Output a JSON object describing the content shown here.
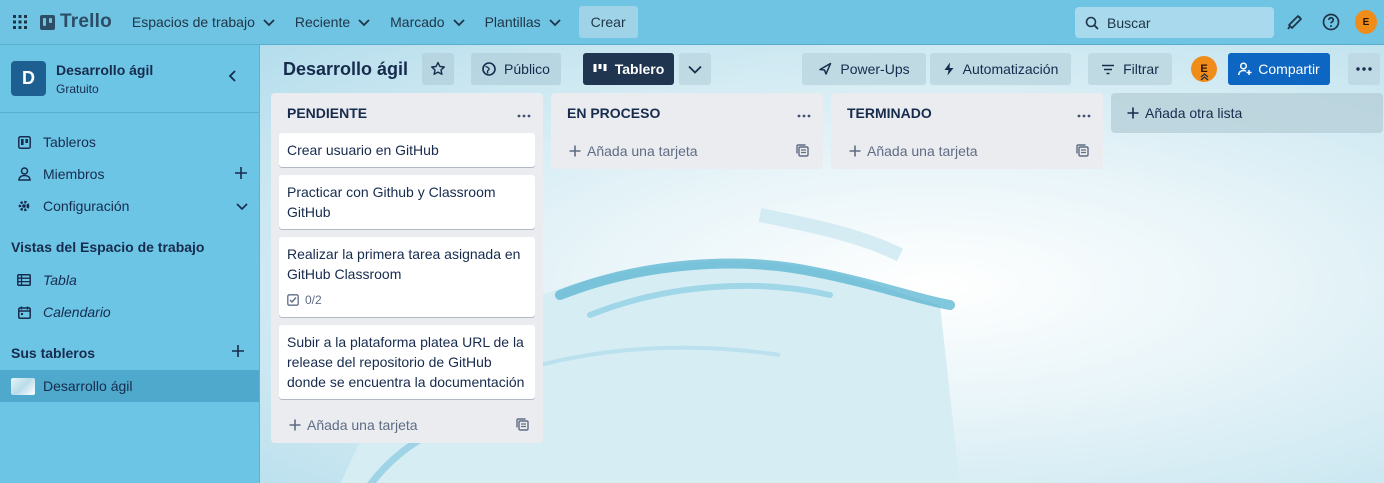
{
  "topnav": {
    "logo_text": "Trello",
    "menus": [
      {
        "label": "Espacios de trabajo"
      },
      {
        "label": "Reciente"
      },
      {
        "label": "Marcado"
      },
      {
        "label": "Plantillas"
      }
    ],
    "create_label": "Crear",
    "search_placeholder": "Buscar",
    "avatar_initial": "E"
  },
  "sidebar": {
    "workspace_initial": "D",
    "workspace_name": "Desarrollo ágil",
    "workspace_plan": "Gratuito",
    "items": [
      {
        "label": "Tableros",
        "icon": "board-icon"
      },
      {
        "label": "Miembros",
        "icon": "person-icon"
      },
      {
        "label": "Configuración",
        "icon": "gear-icon"
      }
    ],
    "views_heading": "Vistas del Espacio de trabajo",
    "views": [
      {
        "label": "Tabla",
        "icon": "table-icon"
      },
      {
        "label": "Calendario",
        "icon": "calendar-icon"
      }
    ],
    "boards_heading": "Sus tableros",
    "boards": [
      {
        "label": "Desarrollo ágil"
      }
    ]
  },
  "board": {
    "title": "Desarrollo ágil",
    "visibility_label": "Público",
    "view_label": "Tablero",
    "powerups_label": "Power-Ups",
    "automation_label": "Automatización",
    "filter_label": "Filtrar",
    "member_initial": "E",
    "share_label": "Compartir",
    "lists": [
      {
        "title": "PENDIENTE",
        "cards": [
          {
            "text": "Crear usuario en GitHub"
          },
          {
            "text": "Practicar con Github y Classroom GitHub"
          },
          {
            "text": "Realizar la primera tarea asignada en GitHub Classroom",
            "checklist": "0/2"
          },
          {
            "text": "Subir a la plataforma platea URL de la release del repositorio de GitHub donde se encuentra la documentación"
          }
        ],
        "add_card_label": "Añada una tarjeta"
      },
      {
        "title": "EN PROCESO",
        "cards": [],
        "add_card_label": "Añada una tarjeta"
      },
      {
        "title": "TERMINADO",
        "cards": [],
        "add_card_label": "Añada una tarjeta"
      }
    ],
    "add_list_label": "Añada otra lista"
  },
  "colors": {
    "topnav_bg": "#6fc3e3",
    "sidebar_bg": "#6dc5e6",
    "board_view_button": "#1f3550",
    "share_button": "#0c66c2",
    "avatar": "#f08c1a",
    "workspace_logo": "#1e5f91"
  }
}
